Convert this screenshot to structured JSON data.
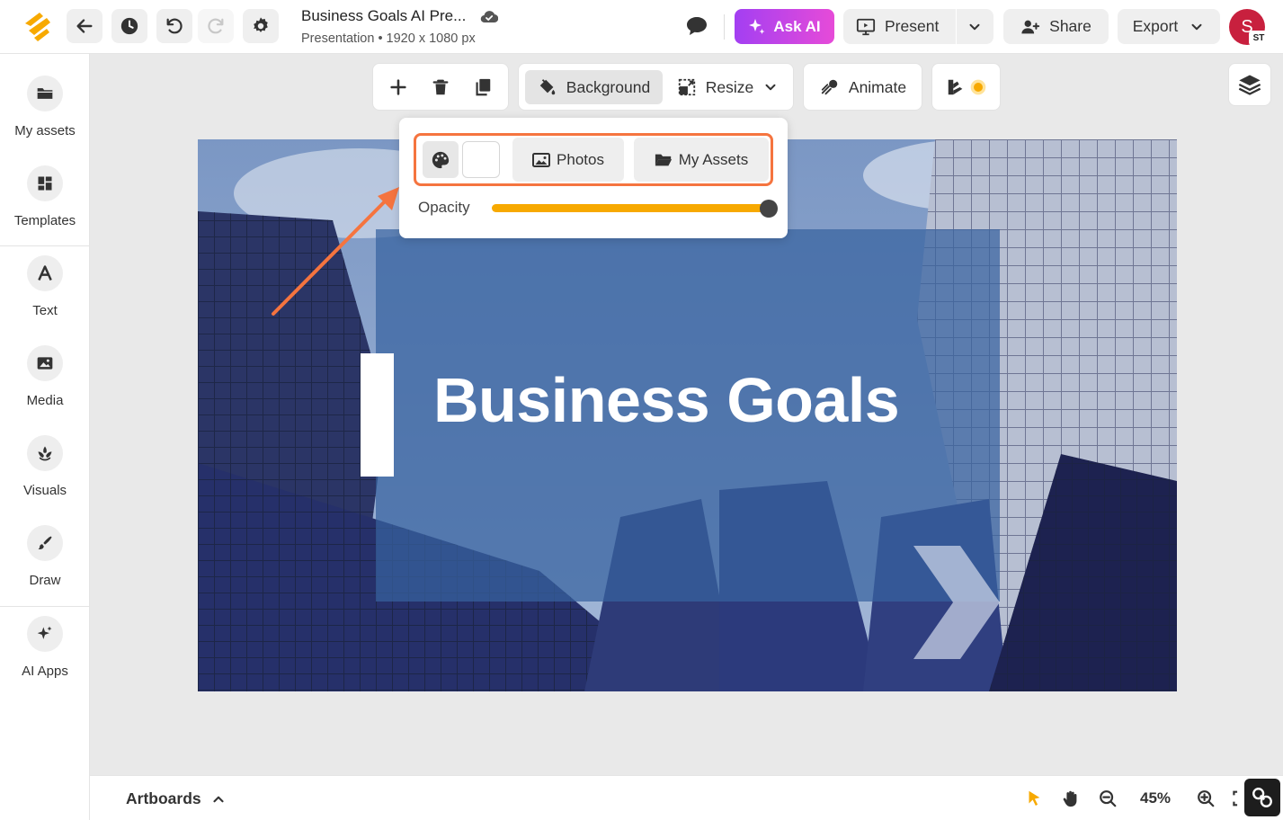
{
  "document": {
    "title": "Business Goals AI Pre...",
    "subtitle": "Presentation • 1920 x 1080 px"
  },
  "topbar": {
    "ask_ai_label": "Ask AI",
    "present_label": "Present",
    "share_label": "Share",
    "export_label": "Export",
    "avatar_initial": "S",
    "avatar_badge": "ST"
  },
  "sidebar": {
    "items": [
      {
        "label": "My assets",
        "icon": "folder-icon"
      },
      {
        "label": "Templates",
        "icon": "templates-icon"
      },
      {
        "label": "Text",
        "icon": "text-icon"
      },
      {
        "label": "Media",
        "icon": "image-icon"
      },
      {
        "label": "Visuals",
        "icon": "visuals-icon"
      },
      {
        "label": "Draw",
        "icon": "brush-icon"
      },
      {
        "label": "AI Apps",
        "icon": "sparkle-icon"
      }
    ]
  },
  "canvas_toolbar": {
    "background_label": "Background",
    "resize_label": "Resize",
    "animate_label": "Animate"
  },
  "background_popover": {
    "photos_label": "Photos",
    "my_assets_label": "My Assets",
    "opacity_label": "Opacity",
    "opacity_value": 1.0,
    "swatch_color": "#ffffff"
  },
  "slide": {
    "title": "Business Goals"
  },
  "bottombar": {
    "artboards_label": "Artboards",
    "zoom_level": "45%"
  },
  "colors": {
    "accent_orange": "#f5743f",
    "slider_fill": "#f7a900",
    "ask_ai_gradient_start": "#a33ff2",
    "ask_ai_gradient_end": "#e64bd8",
    "avatar": "#c8203e"
  }
}
